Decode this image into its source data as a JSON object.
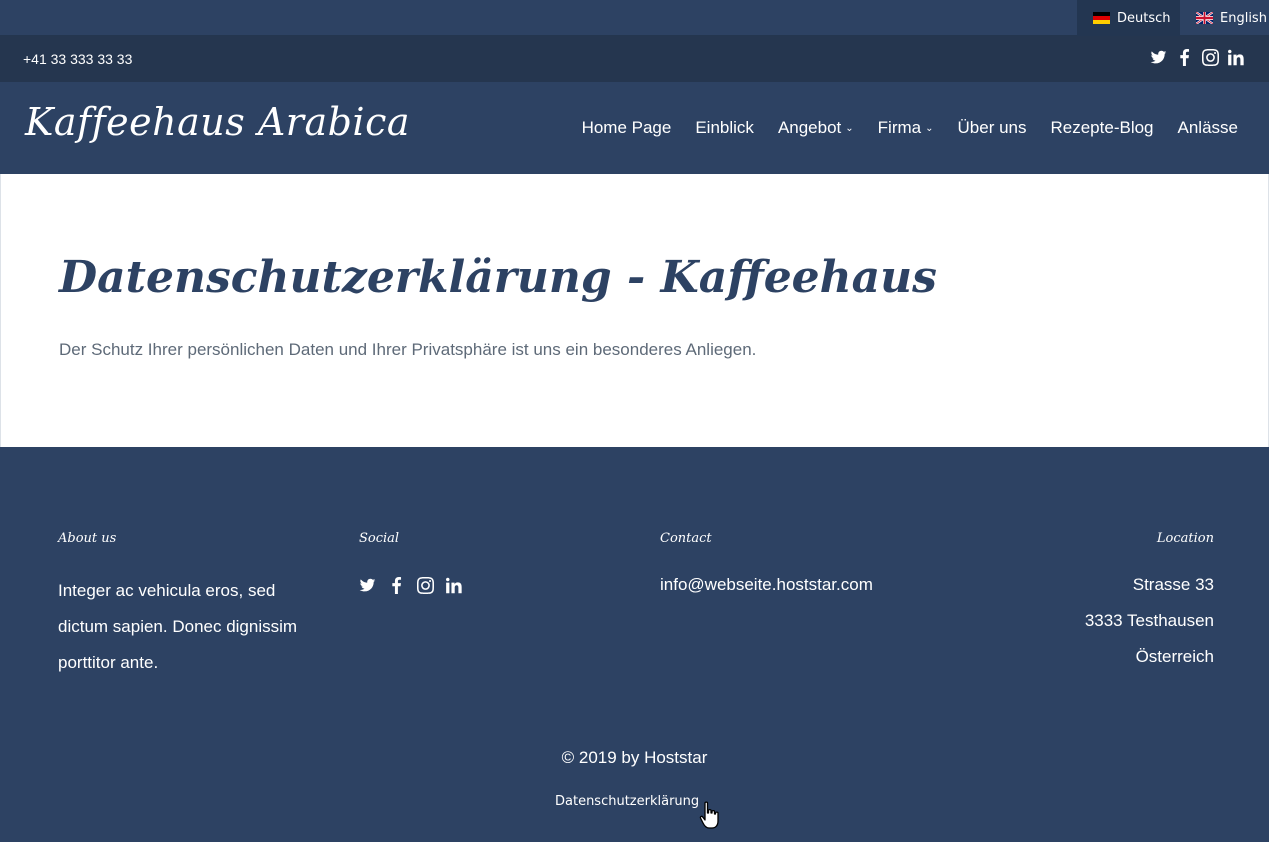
{
  "languages": [
    {
      "label": "Deutsch",
      "active": true
    },
    {
      "label": "English",
      "active": false
    }
  ],
  "topbar": {
    "phone": "+41 33 333 33 33",
    "social_icons": [
      "twitter-icon",
      "facebook-icon",
      "instagram-icon",
      "linkedin-icon"
    ]
  },
  "header": {
    "logo": "Kaffeehaus Arabica",
    "nav": [
      {
        "label": "Home Page",
        "dropdown": false
      },
      {
        "label": "Einblick",
        "dropdown": false
      },
      {
        "label": "Angebot",
        "dropdown": true
      },
      {
        "label": "Firma",
        "dropdown": true
      },
      {
        "label": "Über uns",
        "dropdown": false
      },
      {
        "label": "Rezepte-Blog",
        "dropdown": false
      },
      {
        "label": "Anlässe",
        "dropdown": false
      }
    ]
  },
  "main": {
    "title": "Datenschutzerklärung - Kaffeehaus",
    "subtitle": "Der Schutz Ihrer persönlichen Daten und Ihrer Privatsphäre ist uns ein besonderes Anliegen."
  },
  "footer": {
    "about_heading": "About us",
    "about_text": "Integer ac vehicula eros, sed dictum sapien. Donec dignissim porttitor ante.",
    "social_heading": "Social",
    "contact_heading": "Contact",
    "contact_email": "info@webseite.hoststar.com",
    "location_heading": "Location",
    "location_lines": [
      "Strasse 33",
      "3333 Testhausen",
      "Österreich"
    ],
    "copyright": "© 2019 by Hoststar",
    "privacy_link": "Datenschutzerklärung"
  },
  "colors": {
    "primary": "#2d4263",
    "topbar": "#25364f",
    "text_muted": "#5e6a78",
    "white": "#ffffff"
  }
}
